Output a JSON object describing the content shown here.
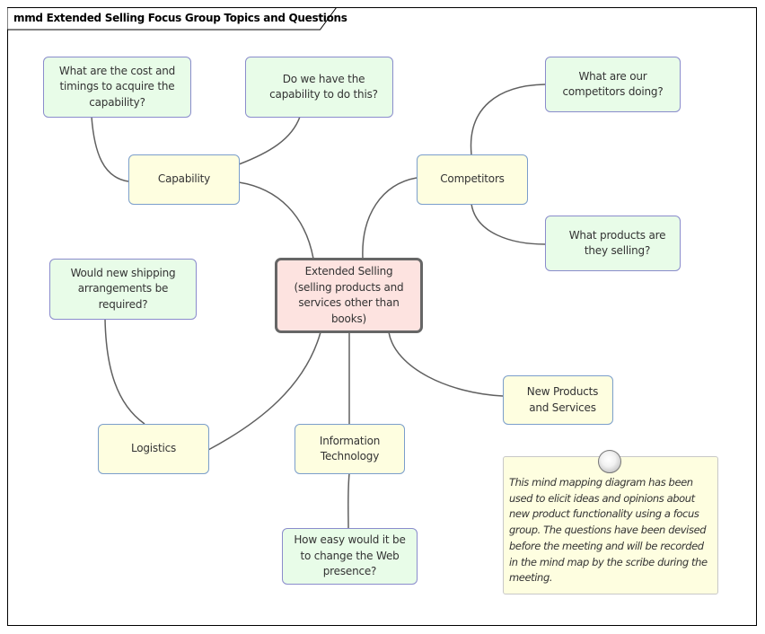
{
  "diagram": {
    "title": "mmd Extended Selling Focus Group Topics and Questions",
    "colors": {
      "question_fill": "#e8fce8",
      "question_border": "#8a8ccc",
      "topic_fill": "#fefee0",
      "topic_border": "#7b9ecb",
      "central_fill": "#fde3e0",
      "central_border": "#666666",
      "connector": "#606060"
    },
    "central": {
      "label": "Extended Selling (selling products and services other than books)"
    },
    "topics": {
      "capability": {
        "label": "Capability"
      },
      "competitors": {
        "label": "Competitors"
      },
      "logistics": {
        "label": "Logistics"
      },
      "information_technology": {
        "label": "Information Technology"
      },
      "new_products": {
        "label": "New Products and Services"
      }
    },
    "questions": {
      "cost_timings": {
        "label": "What are the cost and timings to acquire the capability?"
      },
      "have_capability": {
        "label": "Do we have the capability to do this?"
      },
      "competitors_doing": {
        "label": "What are our competitors doing?"
      },
      "products_selling": {
        "label": "What products are they selling?"
      },
      "shipping": {
        "label": "Would new shipping arrangements be required?"
      },
      "web_presence": {
        "label": "How easy would it be to change the Web presence?"
      }
    },
    "note": {
      "text": "This mind mapping diagram has been used to elicit ideas and opinions about new product functionality using a focus group. The questions have been devised before the meeting and will be recorded in the mind map by the scribe during the meeting."
    },
    "connections": [
      {
        "from": "central",
        "to": "capability"
      },
      {
        "from": "central",
        "to": "competitors"
      },
      {
        "from": "central",
        "to": "logistics"
      },
      {
        "from": "central",
        "to": "information_technology"
      },
      {
        "from": "central",
        "to": "new_products"
      },
      {
        "from": "capability",
        "to": "cost_timings"
      },
      {
        "from": "capability",
        "to": "have_capability"
      },
      {
        "from": "competitors",
        "to": "competitors_doing"
      },
      {
        "from": "competitors",
        "to": "products_selling"
      },
      {
        "from": "logistics",
        "to": "shipping"
      },
      {
        "from": "information_technology",
        "to": "web_presence"
      }
    ]
  }
}
